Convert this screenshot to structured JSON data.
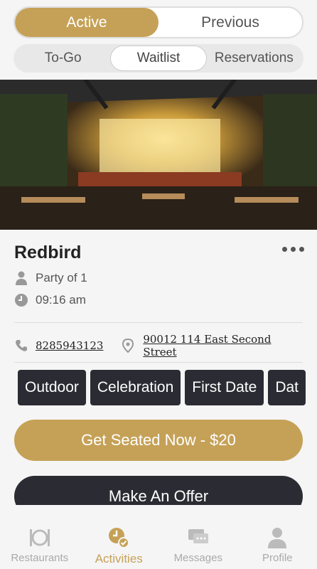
{
  "top_tabs": {
    "active": "Active",
    "previous": "Previous"
  },
  "sub_tabs": {
    "togo": "To-Go",
    "waitlist": "Waitlist",
    "reservations": "Reservations"
  },
  "restaurant": {
    "name": "Redbird",
    "party": "Party of 1",
    "time": "09:16 am",
    "phone": "8285943123",
    "address": "90012 114 East Second Street"
  },
  "tags": [
    "Outdoor",
    "Celebration",
    "First Date",
    "Dat"
  ],
  "actions": {
    "seat_now": "Get Seated Now - $20",
    "offer": "Make An Offer"
  },
  "bottom_nav": {
    "restaurants": "Restaurants",
    "activities": "Activities",
    "messages": "Messages",
    "profile": "Profile"
  },
  "colors": {
    "accent": "#c5a157",
    "dark": "#2b2b33"
  }
}
